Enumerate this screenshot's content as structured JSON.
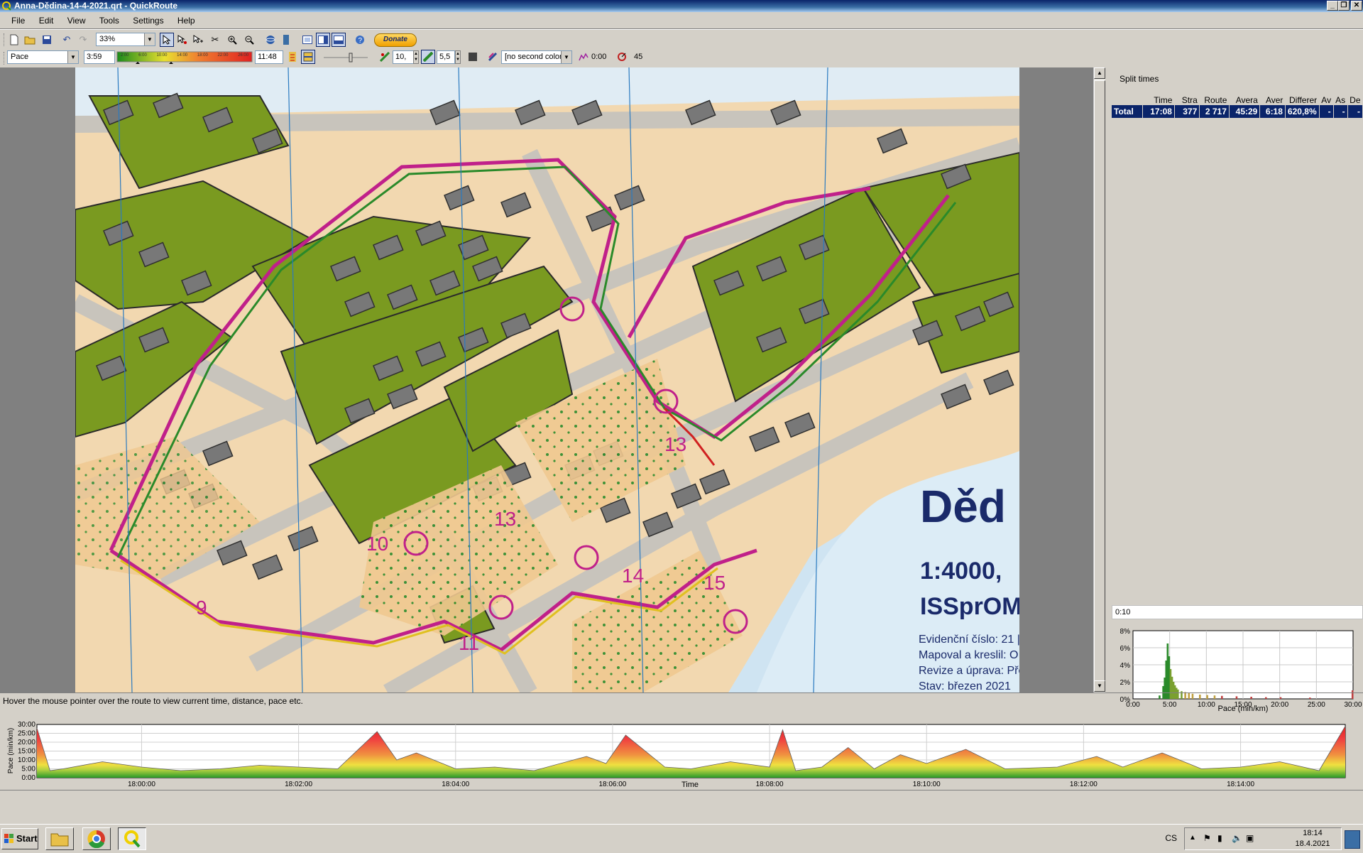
{
  "window": {
    "title": "Anna-Dědina-14-4-2021.qrt - QuickRoute",
    "minimize": "_",
    "restore": "❐",
    "close": "✕"
  },
  "menu": [
    "File",
    "Edit",
    "View",
    "Tools",
    "Settings",
    "Help"
  ],
  "toolbar1": {
    "zoom": "33%",
    "donate": "Donate"
  },
  "toolbar2": {
    "color_coding": "Pace",
    "range_min": "3:59",
    "scale_ticks": [
      "2:00",
      "6:00",
      "10:00",
      "14:00",
      "18:00",
      "22:00",
      "26:00"
    ],
    "range_max": "11:48",
    "line_width": "10,",
    "smoothing": "5,5",
    "second_color": "[no second color",
    "time_offset": "0:00",
    "angle": "45"
  },
  "map": {
    "title_text": "Děd",
    "scale_text": "1:4000, ",
    "org_text": "ISSprOM",
    "info_lines": [
      "Evidenční číslo: 21 |",
      "Mapoval a kreslil: O",
      "Revize a úprava: Pře",
      "Stav: březen 2021"
    ],
    "control_numbers": [
      "10",
      "11",
      "9",
      "13",
      "14",
      "15",
      "13"
    ]
  },
  "split_times": {
    "title": "Split times",
    "headers": [
      "Time",
      "Stra",
      "Route",
      "Avera",
      "Aver",
      "Differer",
      "Av",
      "As",
      "De"
    ],
    "total_row": [
      "Total",
      "17:08",
      "377",
      "2 717",
      "45:29",
      "6:18",
      "620,8%",
      "-",
      "-",
      "-"
    ]
  },
  "histogram": {
    "bin_value": "0:10",
    "y_ticks": [
      "8%",
      "6%",
      "4%",
      "2%",
      "0%"
    ],
    "x_ticks": [
      "0:00",
      "5:00",
      "10:00",
      "15:00",
      "20:00",
      "25:00",
      "30:00"
    ],
    "xlabel": "Pace (min/km)"
  },
  "status_message": "Hover the mouse pointer over the route to view current time, distance, pace etc.",
  "line_graph": {
    "ylabel": "Pace (min/km)",
    "y_ticks": [
      "30:00",
      "25:00",
      "20:00",
      "15:00",
      "10:00",
      "5:00",
      "0:00"
    ],
    "x_ticks": [
      "18:00:00",
      "18:02:00",
      "18:04:00",
      "18:06:00",
      "18:08:00",
      "18:10:00",
      "18:12:00",
      "18:14:00"
    ],
    "xlabel": "Time"
  },
  "chart_data": [
    {
      "type": "bar",
      "title": "",
      "xlabel": "Pace (min/km)",
      "ylabel": "",
      "xlim": [
        0,
        30
      ],
      "ylim": [
        0,
        8
      ],
      "x": [
        3.5,
        4.0,
        4.2,
        4.4,
        4.6,
        4.8,
        5.0,
        5.2,
        5.4,
        5.6,
        5.8,
        6.0,
        6.5,
        7.0,
        7.5,
        8.0,
        9.0,
        10.0,
        11.0,
        12.0,
        14.0,
        16.0,
        18.0,
        20.0,
        24.0,
        29.8
      ],
      "values": [
        0.4,
        1.5,
        2.5,
        4.5,
        6.5,
        5.0,
        3.5,
        2.6,
        2.0,
        1.6,
        1.3,
        1.1,
        0.9,
        0.8,
        0.7,
        0.6,
        0.5,
        0.45,
        0.4,
        0.35,
        0.3,
        0.25,
        0.2,
        0.2,
        0.15,
        1.0
      ]
    },
    {
      "type": "area",
      "title": "",
      "xlabel": "Time",
      "ylabel": "Pace (min/km)",
      "ylim": [
        0,
        30
      ],
      "x_time_labels": [
        "17:58:40",
        "17:58:50",
        "17:59:00",
        "17:59:30",
        "18:00:00",
        "18:00:30",
        "18:01:00",
        "18:01:30",
        "18:02:00",
        "18:02:30",
        "18:03:00",
        "18:03:15",
        "18:03:30",
        "18:04:00",
        "18:04:30",
        "18:05:00",
        "18:05:40",
        "18:05:55",
        "18:06:10",
        "18:06:40",
        "18:07:00",
        "18:07:30",
        "18:08:00",
        "18:08:10",
        "18:08:20",
        "18:08:40",
        "18:09:00",
        "18:09:20",
        "18:09:40",
        "18:10:00",
        "18:10:30",
        "18:11:00",
        "18:11:40",
        "18:12:10",
        "18:12:30",
        "18:13:00",
        "18:13:30",
        "18:14:00",
        "18:14:30",
        "18:15:00",
        "18:15:20"
      ],
      "values": [
        28,
        4,
        5,
        9,
        6,
        4,
        5,
        7,
        6,
        5,
        26,
        10,
        14,
        5,
        6,
        4,
        12,
        8,
        24,
        6,
        5,
        9,
        6,
        27,
        4,
        6,
        17,
        5,
        13,
        8,
        16,
        5,
        6,
        12,
        6,
        14,
        5,
        6,
        9,
        4,
        29
      ]
    }
  ]
}
